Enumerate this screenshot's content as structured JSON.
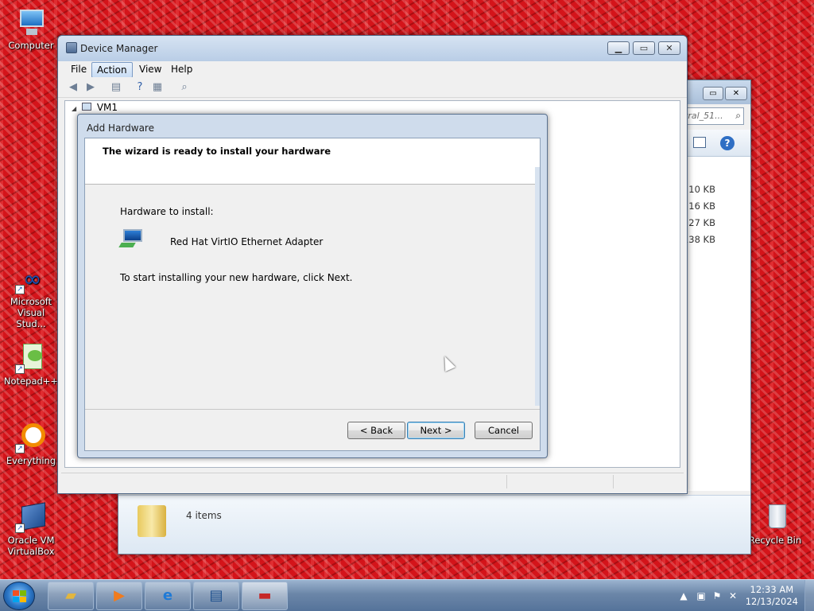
{
  "desktop": {
    "icons": [
      {
        "label": "Computer"
      },
      {
        "label": "Microsoft Visual Stud..."
      },
      {
        "label": "Notepad++"
      },
      {
        "label": "Everything"
      },
      {
        "label": "Oracle VM VirtualBox"
      },
      {
        "label": "Recycle Bin"
      }
    ]
  },
  "explorer": {
    "search_placeholder": "tral_51...",
    "sizes": [
      "10 KB",
      "16 KB",
      "27 KB",
      "138 KB"
    ],
    "status_items": "4 items"
  },
  "device_manager": {
    "title": "Device Manager",
    "menu": [
      "File",
      "Action",
      "View",
      "Help"
    ],
    "active_menu": "Action",
    "tree_root": "VM1"
  },
  "wizard": {
    "title": "Add Hardware",
    "heading": "The wizard is ready to install your hardware",
    "hardware_label": "Hardware to install:",
    "device_name": "Red Hat VirtIO Ethernet Adapter",
    "instruction": "To start installing your new hardware, click Next.",
    "buttons": {
      "back": "< Back",
      "next": "Next >",
      "cancel": "Cancel"
    }
  },
  "taskbar": {
    "time": "12:33 AM",
    "date": "12/13/2024"
  },
  "colors": {
    "accent": "#3c7fb1",
    "desktop_bg": "#d4141a"
  }
}
